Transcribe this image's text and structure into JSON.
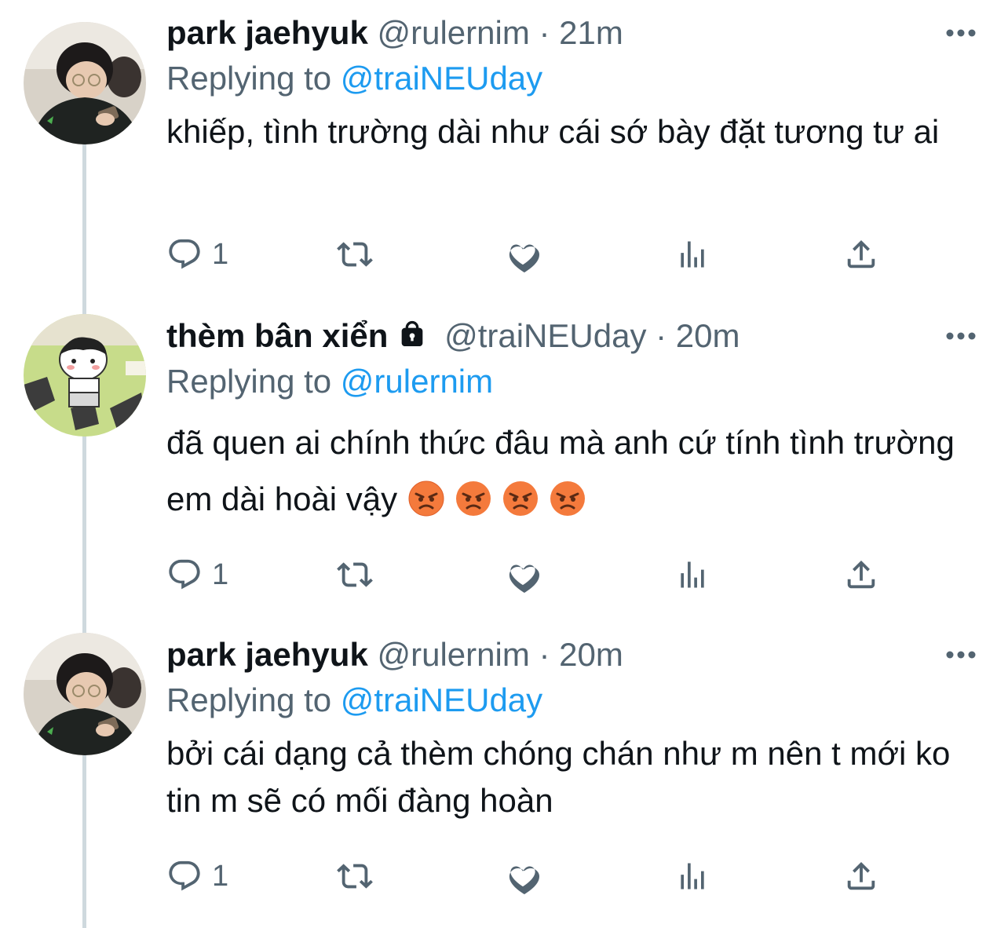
{
  "tweets": [
    {
      "name": "park jaehyuk",
      "handle": "@rulernim",
      "separator": "·",
      "time": "21m",
      "replying_label": "Replying to",
      "replying_to": "@traiNEUday",
      "text": "khiếp, tình trường dài như cái sớ bày đặt tương tư ai",
      "reply_count": "1",
      "locked": false
    },
    {
      "name": "thèm bân xiển",
      "handle": "@traiNEUday",
      "separator": "·",
      "time": "20m",
      "replying_label": "Replying to",
      "replying_to": "@rulernim",
      "text": "đã quen ai chính thức đâu mà anh cứ tính tình trường em dài hoài vậy",
      "emoji": [
        "angry-face",
        "angry-face",
        "angry-face",
        "angry-face"
      ],
      "reply_count": "1",
      "locked": true
    },
    {
      "name": "park jaehyuk",
      "handle": "@rulernim",
      "separator": "·",
      "time": "20m",
      "replying_label": "Replying to",
      "replying_to": "@traiNEUday",
      "text": "bởi cái dạng cả thèm chóng chán như m nên t mới ko tin m sẽ có mối đàng hoàn",
      "reply_count": "1",
      "locked": false
    }
  ],
  "icons": {
    "reply": "reply-icon",
    "retweet": "retweet-icon",
    "like": "heart-icon",
    "views": "analytics-icon",
    "share": "share-icon",
    "more": "more-icon",
    "lock": "lock-icon"
  },
  "colors": {
    "text": "#0f1419",
    "secondary": "#536471",
    "link": "#1d9bf0",
    "thread_line": "#cfd9de"
  }
}
